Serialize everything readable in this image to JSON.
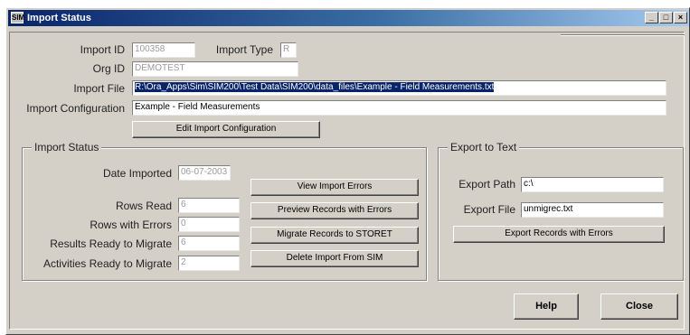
{
  "window": {
    "title": "Import Status",
    "icon": "app-icon",
    "controls": {
      "minimize": "_",
      "maximize": "□",
      "close": "×"
    }
  },
  "header": {
    "import_id_label": "Import ID",
    "import_id_value": "100358",
    "import_type_label": "Import Type",
    "import_type_value": "R",
    "org_id_label": "Org ID",
    "org_id_value": "DEMOTEST",
    "import_file_label": "Import File",
    "import_file_value": "R:\\Ora_Apps\\Sim\\SIM200\\Test Data\\SIM200\\data_files\\Example - Field Measurements.txt",
    "import_config_label": "Import Configuration",
    "import_config_value": "Example - Field Measurements",
    "edit_config_label": "Edit Import Configuration"
  },
  "import_status": {
    "group_title": "Import Status",
    "date_imported_label": "Date Imported",
    "date_imported_value": "06-07-2003",
    "rows_read_label": "Rows Read",
    "rows_read_value": "6",
    "rows_errors_label": "Rows with Errors",
    "rows_errors_value": "0",
    "results_ready_label": "Results Ready to Migrate",
    "results_ready_value": "6",
    "activities_ready_label": "Activities Ready to Migrate",
    "activities_ready_value": "2",
    "buttons": {
      "view_errors": "View Import Errors",
      "preview_errors": "Preview Records with Errors",
      "migrate": "Migrate Records to STORET",
      "delete": "Delete Import From SIM"
    }
  },
  "export": {
    "group_title": "Export to Text",
    "path_label": "Export Path",
    "path_value": "c:\\",
    "file_label": "Export File",
    "file_value": "unmigrec.txt",
    "export_button": "Export Records with Errors"
  },
  "footer": {
    "help": "Help",
    "close": "Close"
  }
}
